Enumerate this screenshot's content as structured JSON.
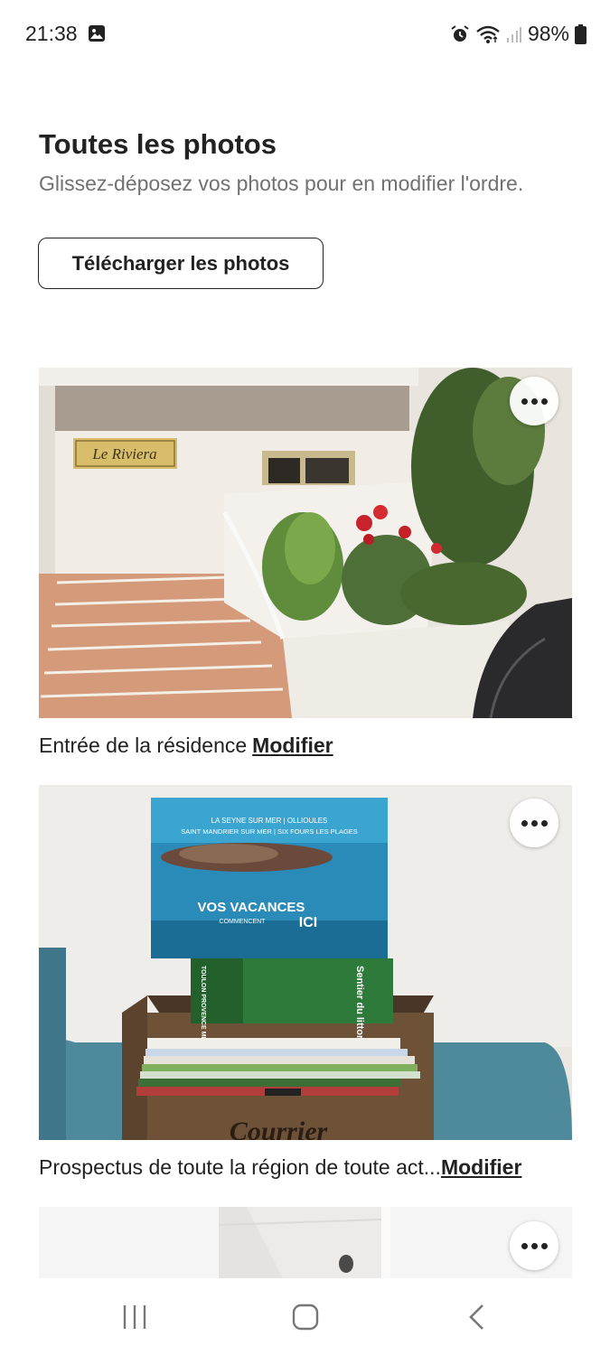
{
  "status_bar": {
    "time": "21:38",
    "battery": "98%",
    "icons": [
      "gallery-icon",
      "alarm-icon",
      "wifi-icon",
      "signal-icon",
      "battery-icon"
    ]
  },
  "page": {
    "title": "Toutes les photos",
    "subtitle": "Glissez-déposez vos photos pour en modifier l'ordre."
  },
  "upload_button": {
    "label": "Télécharger les photos"
  },
  "photos": [
    {
      "caption": "Entrée de la résidence",
      "edit_label": "Modifier",
      "sign_text": "Le Riviera"
    },
    {
      "caption": "Prospectus de toute la région de toute act...",
      "edit_label": "Modifier",
      "poster_lines": [
        "LA SEYNE SUR MER | OLLIOULES",
        "SAINT MANDRIER SUR MER | SIX FOURS LES PLAGES",
        "VOS VACANCES",
        "COMMENCENT",
        "ICI"
      ],
      "book_spines": [
        "Sentier du littoral",
        "TOULON PROVENCE MÉDITERRANÉE"
      ],
      "crate_text": "Courrier"
    },
    {
      "caption": "",
      "edit_label": ""
    }
  ],
  "nav_bar": {
    "icons": [
      "recent-apps-icon",
      "home-icon",
      "back-icon"
    ]
  },
  "colors": {
    "text": "#222222",
    "secondary_text": "#717171",
    "background": "#ffffff"
  }
}
